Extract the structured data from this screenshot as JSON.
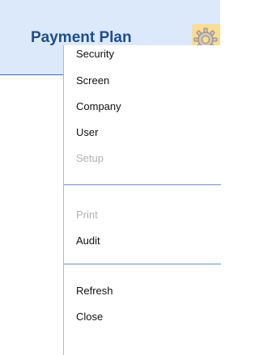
{
  "header": {
    "title": "Payment Plan",
    "settings_icon": "gear-icon"
  },
  "menu": {
    "items": [
      {
        "label": "Security",
        "enabled": true
      },
      {
        "label": "Screen",
        "enabled": true
      },
      {
        "label": "Company",
        "enabled": true
      },
      {
        "label": "User",
        "enabled": true
      },
      {
        "label": "Setup",
        "enabled": false
      },
      {
        "label": "Print",
        "enabled": false
      },
      {
        "label": "Audit",
        "enabled": true
      },
      {
        "label": "Refresh",
        "enabled": true
      },
      {
        "label": "Close",
        "enabled": true
      }
    ]
  },
  "colors": {
    "header_background": "#dce9fb",
    "title_text": "#1f4e87",
    "gear_highlight": "#f9dc95",
    "separator": "#6b8fc6",
    "disabled_text": "#b3b3b3"
  }
}
